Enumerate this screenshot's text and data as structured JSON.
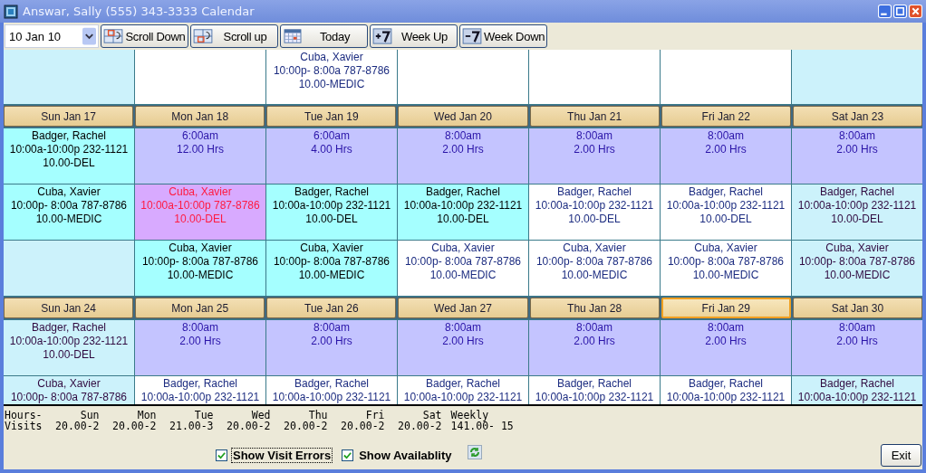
{
  "window": {
    "title": "Answar, Sally (555) 343-3333 Calendar"
  },
  "toolbar": {
    "date_select": {
      "value": "10 Jan 10"
    },
    "buttons": [
      {
        "label": "Scroll Down",
        "kind": "scroll-down"
      },
      {
        "label": "Scroll up",
        "kind": "scroll-up"
      },
      {
        "label": "Today",
        "kind": "today"
      },
      {
        "label": "Week Up",
        "kind": "week-up"
      },
      {
        "label": "Week Down",
        "kind": "week-down"
      }
    ]
  },
  "calendar": {
    "top_rows": [
      [
        {
          "kind": "weekend"
        },
        {
          "kind": "open"
        },
        {
          "kind": "open",
          "lines": [
            "Cuba, Xavier",
            "10:00p- 8:00a 787-8786",
            "10.00-MEDIC"
          ]
        },
        {
          "kind": "open"
        },
        {
          "kind": "open"
        },
        {
          "kind": "open"
        },
        {
          "kind": "weekend"
        }
      ]
    ],
    "weeks": [
      {
        "days": [
          {
            "label": "Sun Jan 17",
            "selected": false
          },
          {
            "label": "Mon Jan 18",
            "selected": false
          },
          {
            "label": "Tue Jan 19",
            "selected": false
          },
          {
            "label": "Wed Jan 20",
            "selected": false
          },
          {
            "label": "Thu Jan 21",
            "selected": false
          },
          {
            "label": "Fri Jan 22",
            "selected": false
          },
          {
            "label": "Sat Jan 23",
            "selected": false
          }
        ],
        "rows": [
          [
            {
              "kind": "visit",
              "lines": [
                "Badger, Rachel",
                "10:00a-10:00p 232-1121",
                "10.00-DEL"
              ]
            },
            {
              "kind": "available",
              "lines": [
                "6:00am",
                "12.00 Hrs"
              ]
            },
            {
              "kind": "available",
              "lines": [
                "6:00am",
                "4.00 Hrs"
              ]
            },
            {
              "kind": "available",
              "lines": [
                "8:00am",
                "2.00 Hrs"
              ]
            },
            {
              "kind": "available",
              "lines": [
                "8:00am",
                "2.00 Hrs"
              ]
            },
            {
              "kind": "available",
              "lines": [
                "8:00am",
                "2.00 Hrs"
              ]
            },
            {
              "kind": "available",
              "lines": [
                "8:00am",
                "2.00 Hrs"
              ]
            }
          ],
          [
            {
              "kind": "visit",
              "lines": [
                "Cuba, Xavier",
                "10:00p- 8:00a 787-8786",
                "10.00-MEDIC"
              ]
            },
            {
              "kind": "error",
              "lines": [
                "Cuba, Xavier",
                "10:00a-10:00p 787-8786",
                "10.00-DEL"
              ]
            },
            {
              "kind": "visit",
              "lines": [
                "Badger, Rachel",
                "10:00a-10:00p 232-1121",
                "10.00-DEL"
              ]
            },
            {
              "kind": "visit",
              "lines": [
                "Badger, Rachel",
                "10:00a-10:00p 232-1121",
                "10.00-DEL"
              ]
            },
            {
              "kind": "open",
              "lines": [
                "Badger, Rachel",
                "10:00a-10:00p 232-1121",
                "10.00-DEL"
              ]
            },
            {
              "kind": "open",
              "lines": [
                "Badger, Rachel",
                "10:00a-10:00p 232-1121",
                "10.00-DEL"
              ]
            },
            {
              "kind": "weekend",
              "lines": [
                "Badger, Rachel",
                "10:00a-10:00p 232-1121",
                "10.00-DEL"
              ]
            }
          ],
          [
            {
              "kind": "weekend"
            },
            {
              "kind": "visit",
              "lines": [
                "Cuba, Xavier",
                "10:00p- 8:00a 787-8786",
                "10.00-MEDIC"
              ]
            },
            {
              "kind": "visit",
              "lines": [
                "Cuba, Xavier",
                "10:00p- 8:00a 787-8786",
                "10.00-MEDIC"
              ]
            },
            {
              "kind": "open",
              "lines": [
                "Cuba, Xavier",
                "10:00p- 8:00a 787-8786",
                "10.00-MEDIC"
              ]
            },
            {
              "kind": "open",
              "lines": [
                "Cuba, Xavier",
                "10:00p- 8:00a 787-8786",
                "10.00-MEDIC"
              ]
            },
            {
              "kind": "open",
              "lines": [
                "Cuba, Xavier",
                "10:00p- 8:00a 787-8786",
                "10.00-MEDIC"
              ]
            },
            {
              "kind": "weekend",
              "lines": [
                "Cuba, Xavier",
                "10:00p- 8:00a 787-8786",
                "10.00-MEDIC"
              ]
            }
          ]
        ]
      },
      {
        "days": [
          {
            "label": "Sun Jan 24",
            "selected": false
          },
          {
            "label": "Mon Jan 25",
            "selected": false
          },
          {
            "label": "Tue Jan 26",
            "selected": false
          },
          {
            "label": "Wed Jan 27",
            "selected": false
          },
          {
            "label": "Thu Jan 28",
            "selected": false
          },
          {
            "label": "Fri Jan 29",
            "selected": true
          },
          {
            "label": "Sat Jan 30",
            "selected": false
          }
        ],
        "rows": [
          [
            {
              "kind": "weekend",
              "lines": [
                "Badger, Rachel",
                "10:00a-10:00p 232-1121",
                "10.00-DEL"
              ]
            },
            {
              "kind": "available",
              "lines": [
                "8:00am",
                "2.00 Hrs"
              ]
            },
            {
              "kind": "available",
              "lines": [
                "8:00am",
                "2.00 Hrs"
              ]
            },
            {
              "kind": "available",
              "lines": [
                "8:00am",
                "2.00 Hrs"
              ]
            },
            {
              "kind": "available",
              "lines": [
                "8:00am",
                "2.00 Hrs"
              ]
            },
            {
              "kind": "available",
              "lines": [
                "8:00am",
                "2.00 Hrs"
              ]
            },
            {
              "kind": "available",
              "lines": [
                "8:00am",
                "2.00 Hrs"
              ]
            }
          ],
          [
            {
              "kind": "weekend",
              "lines": [
                "Cuba, Xavier",
                "10:00p- 8:00a 787-8786"
              ]
            },
            {
              "kind": "open",
              "lines": [
                "Badger, Rachel",
                "10:00a-10:00p 232-1121"
              ]
            },
            {
              "kind": "open",
              "lines": [
                "Badger, Rachel",
                "10:00a-10:00p 232-1121"
              ]
            },
            {
              "kind": "open",
              "lines": [
                "Badger, Rachel",
                "10:00a-10:00p 232-1121"
              ]
            },
            {
              "kind": "open",
              "lines": [
                "Badger, Rachel",
                "10:00a-10:00p 232-1121"
              ]
            },
            {
              "kind": "open",
              "lines": [
                "Badger, Rachel",
                "10:00a-10:00p 232-1121"
              ]
            },
            {
              "kind": "weekend",
              "lines": [
                "Badger, Rachel",
                "10:00a-10:00p 232-1121"
              ]
            }
          ]
        ]
      }
    ]
  },
  "summary": {
    "row_labels": [
      "Hours-",
      "Visits"
    ],
    "columns": [
      {
        "heading": "Sun",
        "value": "20.00-2"
      },
      {
        "heading": "Mon",
        "value": "20.00-2"
      },
      {
        "heading": "Tue",
        "value": "21.00-3"
      },
      {
        "heading": "Wed",
        "value": "20.00-2"
      },
      {
        "heading": "Thu",
        "value": "20.00-2"
      },
      {
        "heading": "Fri",
        "value": "20.00-2"
      },
      {
        "heading": "Sat",
        "value": "20.00-2"
      },
      {
        "heading": "Weekly",
        "value": "141.00- 15"
      }
    ]
  },
  "options": [
    {
      "label": "Show Visit Errors",
      "checked": true,
      "focused": true
    },
    {
      "label": "Show Availablity",
      "checked": true,
      "focused": false
    }
  ],
  "exit_button": {
    "label": "Exit"
  }
}
